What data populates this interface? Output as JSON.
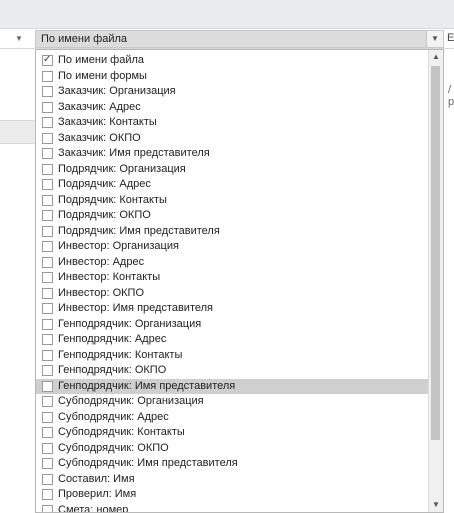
{
  "combo": {
    "selected_value": "По имени файла",
    "arrow_icon": "chevron-down-icon"
  },
  "edge_letters": {
    "right_top": "Е",
    "right_mid": "/р"
  },
  "dropdown": {
    "items": [
      {
        "label": "По имени файла",
        "checked": true
      },
      {
        "label": "По имени формы",
        "checked": false
      },
      {
        "label": "Заказчик: Организация",
        "checked": false
      },
      {
        "label": "Заказчик: Адрес",
        "checked": false
      },
      {
        "label": "Заказчик: Контакты",
        "checked": false
      },
      {
        "label": "Заказчик: ОКПО",
        "checked": false
      },
      {
        "label": "Заказчик: Имя представителя",
        "checked": false
      },
      {
        "label": "Подрядчик: Организация",
        "checked": false
      },
      {
        "label": "Подрядчик: Адрес",
        "checked": false
      },
      {
        "label": "Подрядчик: Контакты",
        "checked": false
      },
      {
        "label": "Подрядчик: ОКПО",
        "checked": false
      },
      {
        "label": "Подрядчик: Имя представителя",
        "checked": false
      },
      {
        "label": "Инвестор: Организация",
        "checked": false
      },
      {
        "label": "Инвестор: Адрес",
        "checked": false
      },
      {
        "label": "Инвестор: Контакты",
        "checked": false
      },
      {
        "label": "Инвестор: ОКПО",
        "checked": false
      },
      {
        "label": "Инвестор: Имя представителя",
        "checked": false
      },
      {
        "label": "Генподрядчик: Организация",
        "checked": false
      },
      {
        "label": "Генподрядчик: Адрес",
        "checked": false
      },
      {
        "label": "Генподрядчик: Контакты",
        "checked": false
      },
      {
        "label": "Генподрядчик: ОКПО",
        "checked": false
      },
      {
        "label": "Генподрядчик: Имя представителя",
        "checked": false,
        "highlighted": true
      },
      {
        "label": "Субподрядчик: Организация",
        "checked": false
      },
      {
        "label": "Субподрядчик: Адрес",
        "checked": false
      },
      {
        "label": "Субподрядчик: Контакты",
        "checked": false
      },
      {
        "label": "Субподрядчик: ОКПО",
        "checked": false
      },
      {
        "label": "Субподрядчик: Имя представителя",
        "checked": false
      },
      {
        "label": "Составил: Имя",
        "checked": false
      },
      {
        "label": "Проверил: Имя",
        "checked": false
      },
      {
        "label": "Смета: номер",
        "checked": false
      }
    ]
  },
  "scrollbar": {
    "up_icon": "chevron-up-icon",
    "down_icon": "chevron-down-icon"
  }
}
